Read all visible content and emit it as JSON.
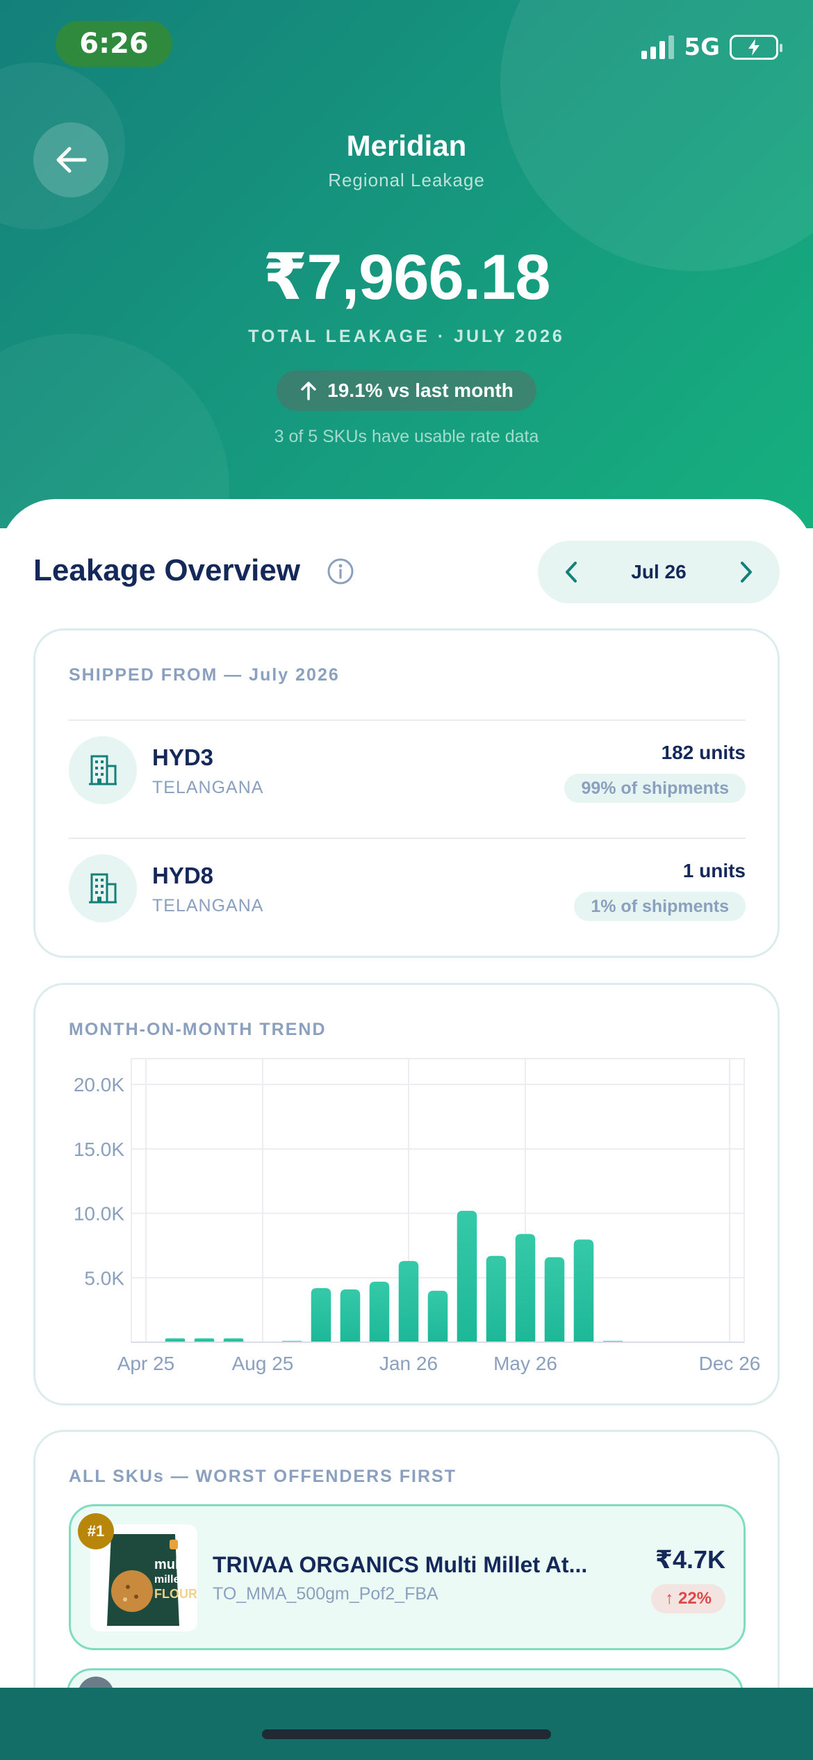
{
  "status_bar": {
    "time": "6:26",
    "network": "5G"
  },
  "header": {
    "title": "Meridian",
    "subtitle": "Regional Leakage",
    "total_amount": "₹7,966.18",
    "total_label": "TOTAL LEAKAGE · JULY 2026",
    "change_text": "19.1% vs last month",
    "sku_note": "3 of 5 SKUs have usable rate data"
  },
  "overview": {
    "title": "Leakage Overview",
    "month": "Jul 26"
  },
  "shipped_from": {
    "title": "SHIPPED FROM — July 2026",
    "rows": [
      {
        "code": "HYD3",
        "state": "TELANGANA",
        "units": "182 units",
        "share": "99% of shipments"
      },
      {
        "code": "HYD8",
        "state": "TELANGANA",
        "units": "1 units",
        "share": "1% of shipments"
      }
    ]
  },
  "trend": {
    "title": "MONTH-ON-MONTH TREND"
  },
  "chart_data": {
    "type": "bar",
    "ylim": [
      0,
      22000
    ],
    "y_ticks": [
      "5.0K",
      "10.0K",
      "15.0K",
      "20.0K"
    ],
    "y_tick_values": [
      5000,
      10000,
      15000,
      20000
    ],
    "x_tick_labels": [
      "Apr 25",
      "Aug 25",
      "Jan 26",
      "May 26",
      "Dec 26"
    ],
    "categories": [
      "Apr 25",
      "May 25",
      "Jun 25",
      "Jul 25",
      "Aug 25",
      "Sep 25",
      "Oct 25",
      "Nov 25",
      "Dec 25",
      "Jan 26",
      "Feb 26",
      "Mar 26",
      "Apr 26",
      "May 26",
      "Jun 26",
      "Jul 26",
      "Aug 26",
      "Sep 26",
      "Oct 26",
      "Nov 26",
      "Dec 26"
    ],
    "values": [
      0,
      300,
      300,
      300,
      0,
      100,
      4200,
      4100,
      4700,
      6300,
      4000,
      10200,
      6700,
      8400,
      6600,
      7966,
      100,
      0,
      0,
      0,
      0
    ],
    "grid": true
  },
  "skus": {
    "title": "ALL SKUs — WORST OFFENDERS FIRST",
    "items": [
      {
        "rank": "#1",
        "name": "TRIVAA ORGANICS Multi Millet At...",
        "code": "TO_MMA_500gm_Pof2_FBA",
        "amount": "₹4.7K",
        "change": "↑ 22%",
        "thumb_text_1": "multi",
        "thumb_text_2": "millets",
        "thumb_text_3": "FLOUR"
      }
    ]
  },
  "colors": {
    "accent": "#14807a",
    "bar": "#22bd9c",
    "navy": "#14285a",
    "muted": "#8aa0be",
    "danger": "#e04848"
  }
}
